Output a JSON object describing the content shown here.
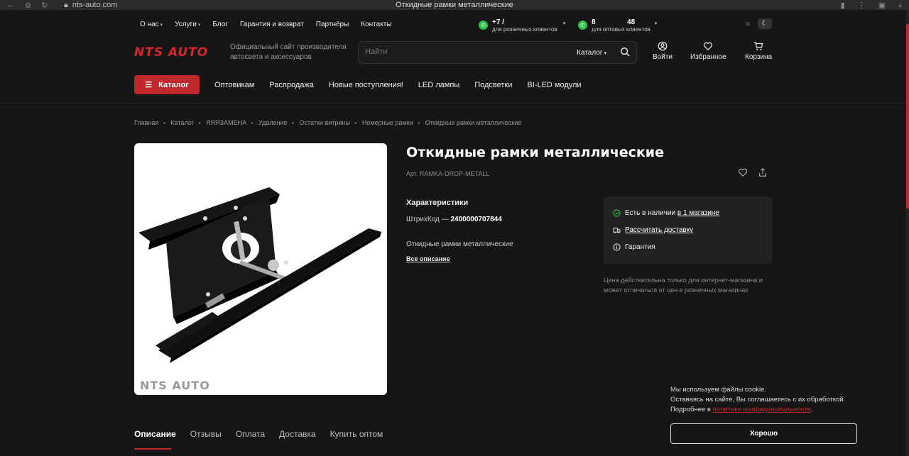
{
  "browser": {
    "url": "nts-auto.com",
    "title": "Откидные рамки металлические"
  },
  "topnav": [
    {
      "label": "О нас",
      "dropdown": true
    },
    {
      "label": "Услуги",
      "dropdown": true
    },
    {
      "label": "Блог",
      "dropdown": false
    },
    {
      "label": "Гарантия и возврат",
      "dropdown": false
    },
    {
      "label": "Партнёры",
      "dropdown": false
    },
    {
      "label": "Контакты",
      "dropdown": false
    }
  ],
  "phones": {
    "retail": {
      "number": "+7 /",
      "caption": "для розничных клиентов"
    },
    "wholesale": {
      "number": "8                48",
      "caption": "для оптовых клиентов"
    }
  },
  "header": {
    "logo": "NTS AUTO",
    "tagline": "Официальный сайт производителя автосвета и аксессуаров",
    "search_placeholder": "Найти",
    "search_catalog": "Каталог",
    "login": "Войти",
    "favorites": "Избранное",
    "cart": "Корзина"
  },
  "catalog_button": "Каталог",
  "mainnav": [
    "Оптовикам",
    "Распродажа",
    "Новые поступления!",
    "LED лампы",
    "Подсветки",
    "BI-LED модули"
  ],
  "breadcrumbs": [
    "Главная",
    "Каталог",
    "ЯЯЯЗАМЕНА",
    "Удаление",
    "Остатки витрины",
    "Номерные рамки",
    "Откидные рамки металлические"
  ],
  "product": {
    "title": "Откидные рамки металлические",
    "article": "Арт. RAMKA-DROP-METALL",
    "characteristics_title": "Характеристики",
    "barcode_label": "ШтрихКод —",
    "barcode_value": "2400000707844",
    "short_description": "Откидные рамки металлические",
    "all_description": "Все описание",
    "image_watermark": "NTS AUTO"
  },
  "stock": {
    "availability": "Есть в наличии",
    "availability_link": "в 1 магазине",
    "delivery": "Рассчитать доставку",
    "warranty": "Гарантия"
  },
  "price_note": "Цена действительна только для интернет-магазина и может отличаться от цен в розничных магазинах",
  "tabs": [
    "Описание",
    "Отзывы",
    "Оплата",
    "Доставка",
    "Купить оптом"
  ],
  "cookie": {
    "line1": "Мы используем файлы cookie.",
    "line2": "Оставаясь на сайте, Вы соглашаетесь с их обработкой.",
    "line3_prefix": "Подробнее в",
    "line3_link": "политике конфиденциальности",
    "button": "Хорошо"
  },
  "colors": {
    "accent": "#c0282d",
    "background": "#161616",
    "panel": "#222222",
    "whatsapp": "#2fbf4a"
  },
  "icons": [
    "back-icon",
    "shield-icon",
    "refresh-icon",
    "lock-icon",
    "whatsapp-icon",
    "sun-icon",
    "moon-icon",
    "search-icon",
    "user-icon",
    "heart-icon",
    "cart-icon",
    "menu-icon",
    "share-icon",
    "check-circle-icon",
    "truck-icon",
    "info-icon",
    "bookmark-icon"
  ]
}
